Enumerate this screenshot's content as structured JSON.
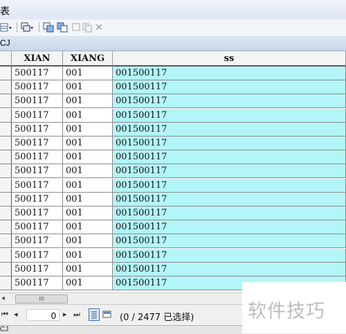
{
  "window": {
    "title_fragment": "表"
  },
  "tab": {
    "label": "CJ"
  },
  "toolbar": {
    "icons": [
      "table-options-icon",
      "related-tables-icon",
      "select-by-attributes-icon",
      "switch-selection-icon",
      "clear-selection-icon",
      "copy-selection-icon",
      "delete-selection-icon"
    ],
    "delete_glyph": "✕"
  },
  "table": {
    "columns": [
      "XIAN",
      "XIANG",
      "ss"
    ],
    "rows": [
      [
        "500117",
        "001",
        "001500117"
      ],
      [
        "500117",
        "001",
        "001500117"
      ],
      [
        "500117",
        "001",
        "001500117"
      ],
      [
        "500117",
        "001",
        "001500117"
      ],
      [
        "500117",
        "001",
        "001500117"
      ],
      [
        "500117",
        "001",
        "001500117"
      ],
      [
        "500117",
        "001",
        "001500117"
      ],
      [
        "500117",
        "001",
        "001500117"
      ],
      [
        "500117",
        "001",
        "001500117"
      ],
      [
        "500117",
        "001",
        "001500117"
      ],
      [
        "500117",
        "001",
        "001500117"
      ],
      [
        "500117",
        "001",
        "001500117"
      ],
      [
        "500117",
        "001",
        "001500117"
      ],
      [
        "500117",
        "001",
        "001500117"
      ],
      [
        "500117",
        "001",
        "001500117"
      ],
      [
        "500117",
        "001",
        "001500117"
      ]
    ],
    "highlight_color": "#b3f5f8"
  },
  "scrollbar": {
    "grip": "III",
    "left_arrow": "◂"
  },
  "navigation": {
    "first": "⏮",
    "prev": "◂",
    "record": "0",
    "next": "▸",
    "last": "⏭",
    "status": "(0 / 2477 已选择)"
  },
  "bottom_tab": {
    "label": "CJ"
  },
  "watermark": {
    "text": "软件技巧"
  }
}
